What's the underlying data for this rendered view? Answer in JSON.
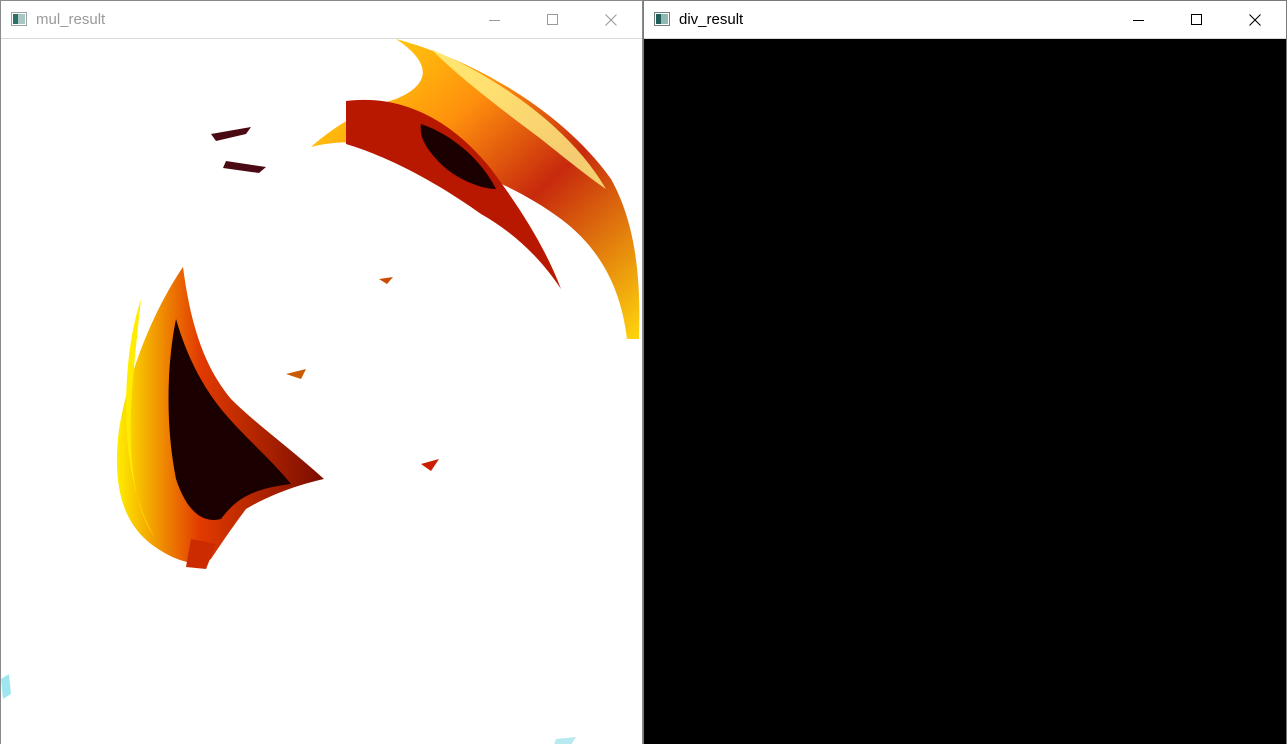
{
  "windows": {
    "mul": {
      "title": "mul_result",
      "state": "inactive",
      "image": {
        "description_icon": "image-content-icon",
        "background": "#ffffff",
        "accent_colors": [
          "#ffe600",
          "#ff7a00",
          "#c81e00",
          "#200000"
        ]
      }
    },
    "div": {
      "title": "div_result",
      "state": "active",
      "image": {
        "background": "#000000"
      }
    }
  },
  "icons": {
    "app": "opencv-window-icon",
    "minimize": "minimize-icon",
    "maximize": "maximize-icon",
    "close": "close-icon"
  }
}
